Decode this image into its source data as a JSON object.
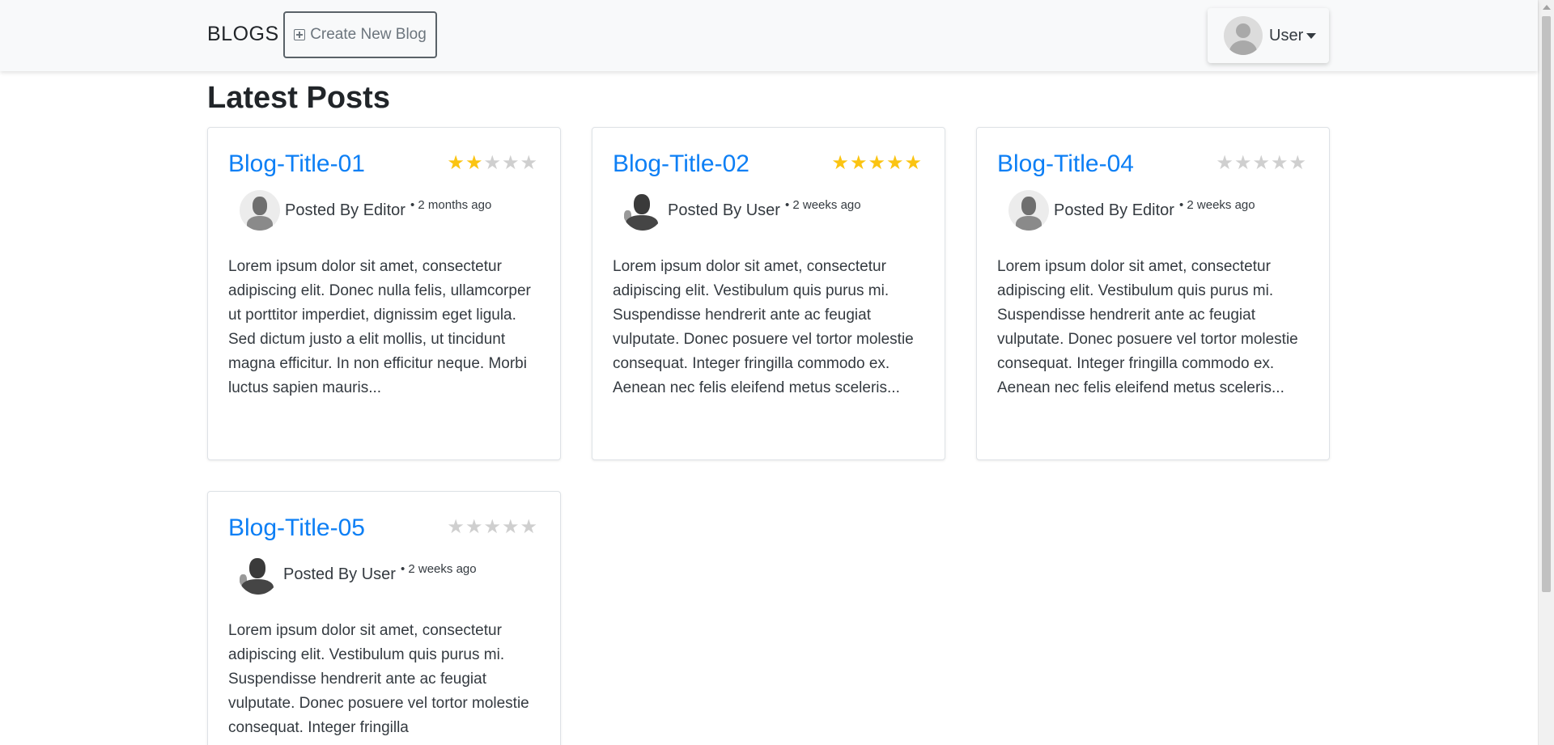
{
  "navbar": {
    "brand": "BLOGS",
    "create_button": "Create New Blog",
    "user_menu_label": "User"
  },
  "main": {
    "title": "Latest Posts",
    "posts": [
      {
        "title": "Blog-Title-01",
        "rating": 2,
        "posted_by": "Posted By Editor",
        "time": "• 2 months ago",
        "excerpt": "Lorem ipsum dolor sit amet, consectetur adipiscing elit. Donec nulla felis, ullamcorper ut porttitor imperdiet, dignissim eget ligula. Sed dictum justo a elit mollis, ut tincidunt magna efficitur. In non efficitur neque. Morbi luctus sapien mauris..."
      },
      {
        "title": "Blog-Title-02",
        "rating": 5,
        "posted_by": "Posted By User",
        "time": "• 2 weeks ago",
        "excerpt": "Lorem ipsum dolor sit amet, consectetur adipiscing elit. Vestibulum quis purus mi. Suspendisse hendrerit ante ac feugiat vulputate. Donec posuere vel tortor molestie consequat. Integer fringilla commodo ex. Aenean nec felis eleifend metus sceleris..."
      },
      {
        "title": "Blog-Title-04",
        "rating": 0,
        "posted_by": "Posted By Editor",
        "time": "• 2 weeks ago",
        "excerpt": "Lorem ipsum dolor sit amet, consectetur adipiscing elit. Vestibulum quis purus mi. Suspendisse hendrerit ante ac feugiat vulputate. Donec posuere vel tortor molestie consequat. Integer fringilla commodo ex. Aenean nec felis eleifend metus sceleris..."
      },
      {
        "title": "Blog-Title-05",
        "rating": 0,
        "posted_by": "Posted By User",
        "time": "• 2 weeks ago",
        "excerpt": "Lorem ipsum dolor sit amet, consectetur adipiscing elit. Vestibulum quis purus mi. Suspendisse hendrerit ante ac feugiat vulputate. Donec posuere vel tortor molestie consequat. Integer fringilla"
      }
    ]
  },
  "colors": {
    "link": "#0d7ff5",
    "star_filled": "#fbc412",
    "star_empty": "#cfcfcf",
    "navbar_bg": "#f8f9fa"
  }
}
